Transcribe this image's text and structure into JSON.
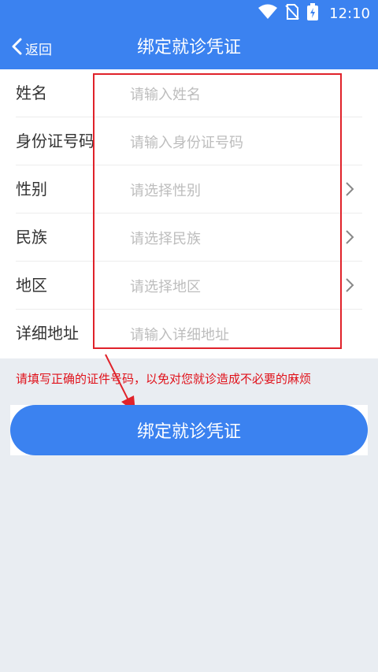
{
  "statusbar": {
    "time": "12:10"
  },
  "navbar": {
    "back_label": "返回",
    "title": "绑定就诊凭证"
  },
  "form": {
    "rows": [
      {
        "label": "姓名",
        "placeholder": "请输入姓名",
        "has_chevron": false
      },
      {
        "label": "身份证号码",
        "placeholder": "请输入身份证号码",
        "has_chevron": false
      },
      {
        "label": "性别",
        "placeholder": "请选择性别",
        "has_chevron": true
      },
      {
        "label": "民族",
        "placeholder": "请选择民族",
        "has_chevron": true
      },
      {
        "label": "地区",
        "placeholder": "请选择地区",
        "has_chevron": true
      },
      {
        "label": "详细地址",
        "placeholder": "请输入详细地址",
        "has_chevron": false
      }
    ]
  },
  "warning_text": "请填写正确的证件号码，以免对您就诊造成不必要的麻烦",
  "submit_label": "绑定就诊凭证",
  "colors": {
    "primary": "#3b82f0",
    "annotation": "#e0222a",
    "background": "#e9edf2"
  }
}
